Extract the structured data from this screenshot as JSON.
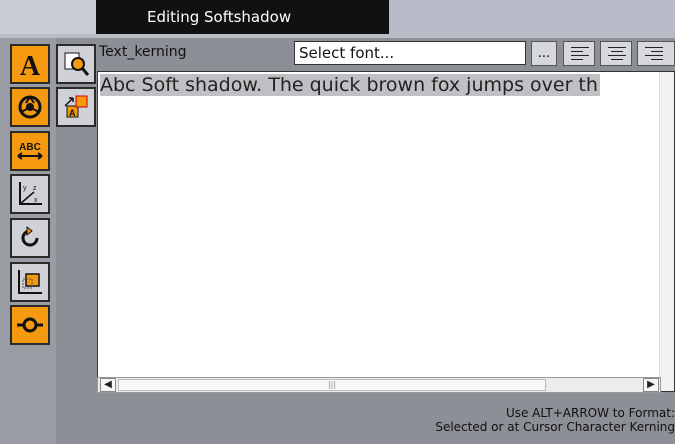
{
  "window": {
    "title": "Editing Softshadow"
  },
  "property": {
    "label": "Text_kerning"
  },
  "font": {
    "select_value": "Select font...",
    "browse_label": "..."
  },
  "editor": {
    "text": "Abc Soft shadow. The quick brown fox jumps over th"
  },
  "status": {
    "line1": "Use ALT+ARROW to Format:",
    "line2": "Selected or at Cursor Character Kerning"
  },
  "tools": [
    "text-tool-icon",
    "material-icon",
    "text-spacing-icon",
    "axis-icon",
    "rotate-icon",
    "position-icon",
    "connector-icon"
  ],
  "colors": {
    "accent": "#f59a10",
    "title_bg": "#111111",
    "panel": "#8d8f96"
  }
}
